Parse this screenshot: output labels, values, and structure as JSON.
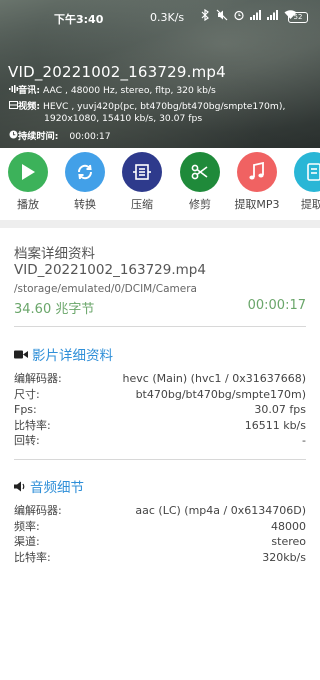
{
  "status_bar": {
    "time": "下午3:40",
    "speed": "0.3K/s",
    "battery": "52",
    "icons": [
      "bluetooth-icon",
      "mute-icon",
      "alarm-icon",
      "signal-icon",
      "signal-icon",
      "wifi-icon",
      "battery-icon"
    ]
  },
  "video": {
    "title": "VID_20221002_163729.mp4",
    "audio_label": "音讯:",
    "audio_value": "AAC , 48000 Hz, stereo, fltp, 320 kb/s",
    "video_label": "视频:",
    "video_value_line1": "HEVC , yuvj420p(pc, bt470bg/bt470bg/smpte170m),",
    "video_value_line2": "1920x1080, 15410 kb/s, 30.07 fps",
    "duration_label": "持续时间:",
    "duration_value": "00:00:17"
  },
  "actions": [
    {
      "label": "播放",
      "icon": "play-icon",
      "color": "#3cb25a"
    },
    {
      "label": "转换",
      "icon": "convert-icon",
      "color": "#42a0e8"
    },
    {
      "label": "压缩",
      "icon": "compress-icon",
      "color": "#2e3a8c"
    },
    {
      "label": "修剪",
      "icon": "scissors-icon",
      "color": "#1f8a3a"
    },
    {
      "label": "提取MP3",
      "icon": "music-note-icon",
      "color": "#f06262"
    },
    {
      "label": "提取(",
      "icon": "extract-icon",
      "color": "#29b6d6"
    }
  ],
  "file_details": {
    "heading": "档案详细资料",
    "name": "VID_20221002_163729.mp4",
    "path": "/storage/emulated/0/DCIM/Camera",
    "size": "34.60 兆字节",
    "duration": "00:00:17"
  },
  "video_details": {
    "heading": "影片详细资料",
    "rows": [
      {
        "k": "编解码器:",
        "v": "hevc (Main) (hvc1 / 0x31637668)"
      },
      {
        "k": "尺寸:",
        "v": "bt470bg/bt470bg/smpte170m)"
      },
      {
        "k": "Fps:",
        "v": "30.07 fps"
      },
      {
        "k": "比特率:",
        "v": "16511 kb/s"
      },
      {
        "k": "回转:",
        "v": "-"
      }
    ]
  },
  "audio_details": {
    "heading": "音频细节",
    "rows": [
      {
        "k": "编解码器:",
        "v": "aac (LC) (mp4a / 0x6134706D)"
      },
      {
        "k": "频率:",
        "v": "48000"
      },
      {
        "k": "渠道:",
        "v": "stereo"
      },
      {
        "k": "比特率:",
        "v": "320kb/s"
      }
    ]
  }
}
